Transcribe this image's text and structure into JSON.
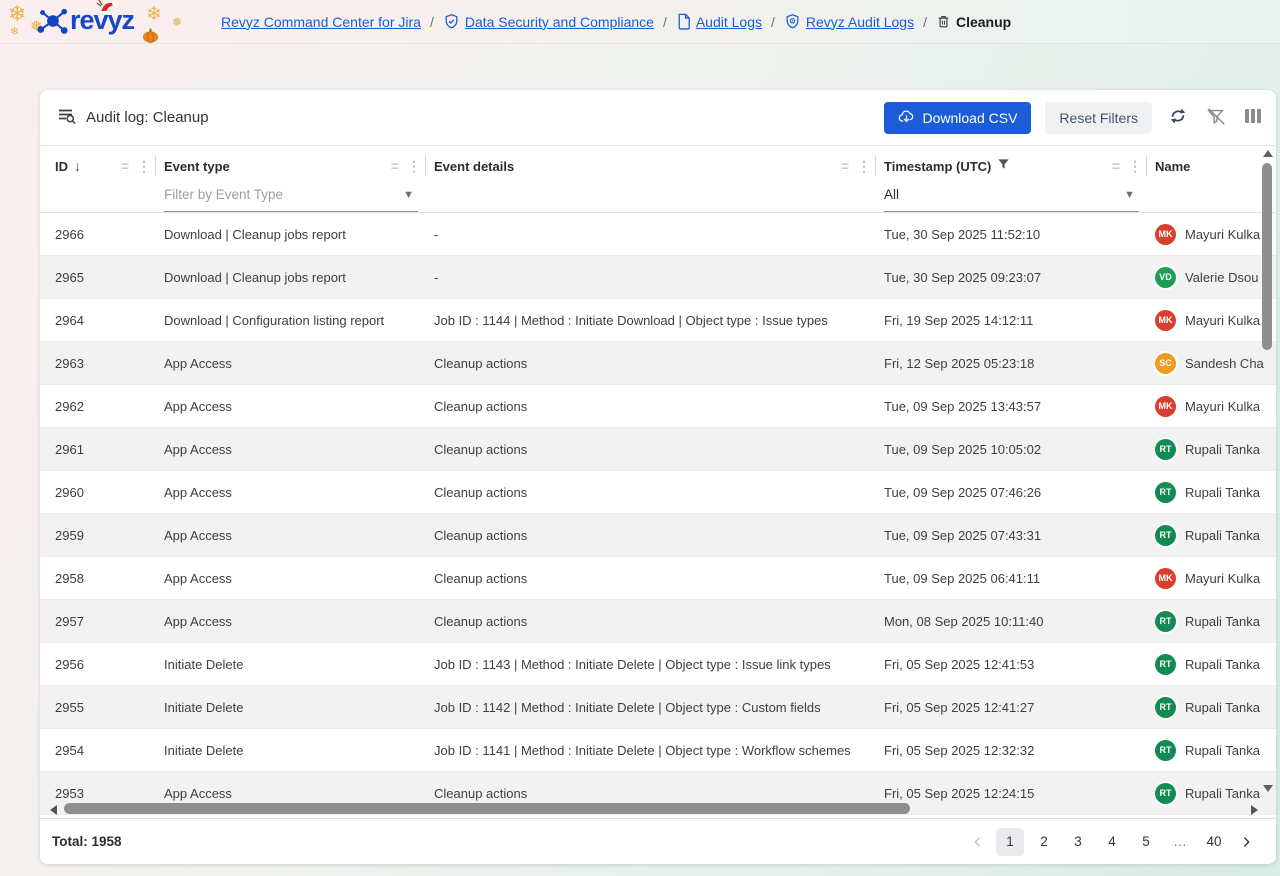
{
  "logo": {
    "brand": "revyz"
  },
  "breadcrumb": {
    "items": [
      {
        "label": "Revyz Command Center for Jira",
        "icon": null,
        "link": true
      },
      {
        "label": "Data Security and Compliance",
        "icon": "shield-check-icon",
        "link": true
      },
      {
        "label": "Audit Logs",
        "icon": "document-icon",
        "link": true
      },
      {
        "label": "Revyz Audit Logs",
        "icon": "shield-scan-icon",
        "link": true
      },
      {
        "label": "Cleanup",
        "icon": "trash-icon",
        "link": false
      }
    ],
    "separator": "/"
  },
  "toolbar": {
    "title": "Audit log: Cleanup",
    "title_icon": "list-search-icon",
    "download_label": "Download CSV",
    "download_icon": "cloud-download-icon",
    "reset_label": "Reset Filters",
    "icons": [
      "refresh-icon",
      "filter-off-icon",
      "columns-icon"
    ]
  },
  "table": {
    "columns": [
      {
        "label": "ID",
        "sort": "desc",
        "sort_glyph": "↓"
      },
      {
        "label": "Event type",
        "filter_placeholder": "Filter by Event Type"
      },
      {
        "label": "Event details"
      },
      {
        "label": "Timestamp (UTC)",
        "filtered": true,
        "filter_value": "All"
      },
      {
        "label": "Name"
      }
    ],
    "rows": [
      {
        "id": "2966",
        "event_type": "Download | Cleanup jobs report",
        "event_details": "-",
        "timestamp": "Tue, 30 Sep 2025 11:52:10",
        "initials": "MK",
        "name": "Mayuri Kulka",
        "avatar_color": "#d6402c"
      },
      {
        "id": "2965",
        "event_type": "Download | Cleanup jobs report",
        "event_details": "-",
        "timestamp": "Tue, 30 Sep 2025 09:23:07",
        "initials": "VD",
        "name": "Valerie Dsou",
        "avatar_color": "#1f9d55"
      },
      {
        "id": "2964",
        "event_type": "Download | Configuration listing report",
        "event_details": "Job ID : 1144 | Method : Initiate Download | Object type : Issue types",
        "timestamp": "Fri, 19 Sep 2025 14:12:11",
        "initials": "MK",
        "name": "Mayuri Kulka",
        "avatar_color": "#d6402c"
      },
      {
        "id": "2963",
        "event_type": "App Access",
        "event_details": "Cleanup actions",
        "timestamp": "Fri, 12 Sep 2025 05:23:18",
        "initials": "SC",
        "name": "Sandesh Cha",
        "avatar_color": "#f09a1e"
      },
      {
        "id": "2962",
        "event_type": "App Access",
        "event_details": "Cleanup actions",
        "timestamp": "Tue, 09 Sep 2025 13:43:57",
        "initials": "MK",
        "name": "Mayuri Kulka",
        "avatar_color": "#d6402c"
      },
      {
        "id": "2961",
        "event_type": "App Access",
        "event_details": "Cleanup actions",
        "timestamp": "Tue, 09 Sep 2025 10:05:02",
        "initials": "RT",
        "name": "Rupali Tanka",
        "avatar_color": "#128a52"
      },
      {
        "id": "2960",
        "event_type": "App Access",
        "event_details": "Cleanup actions",
        "timestamp": "Tue, 09 Sep 2025 07:46:26",
        "initials": "RT",
        "name": "Rupali Tanka",
        "avatar_color": "#128a52"
      },
      {
        "id": "2959",
        "event_type": "App Access",
        "event_details": "Cleanup actions",
        "timestamp": "Tue, 09 Sep 2025 07:43:31",
        "initials": "RT",
        "name": "Rupali Tanka",
        "avatar_color": "#128a52"
      },
      {
        "id": "2958",
        "event_type": "App Access",
        "event_details": "Cleanup actions",
        "timestamp": "Tue, 09 Sep 2025 06:41:11",
        "initials": "MK",
        "name": "Mayuri Kulka",
        "avatar_color": "#d6402c"
      },
      {
        "id": "2957",
        "event_type": "App Access",
        "event_details": "Cleanup actions",
        "timestamp": "Mon, 08 Sep 2025 10:11:40",
        "initials": "RT",
        "name": "Rupali Tanka",
        "avatar_color": "#128a52"
      },
      {
        "id": "2956",
        "event_type": "Initiate Delete",
        "event_details": "Job ID : 1143 | Method : Initiate Delete | Object type : Issue link types",
        "timestamp": "Fri, 05 Sep 2025 12:41:53",
        "initials": "RT",
        "name": "Rupali Tanka",
        "avatar_color": "#128a52"
      },
      {
        "id": "2955",
        "event_type": "Initiate Delete",
        "event_details": "Job ID : 1142 | Method : Initiate Delete | Object type : Custom fields",
        "timestamp": "Fri, 05 Sep 2025 12:41:27",
        "initials": "RT",
        "name": "Rupali Tanka",
        "avatar_color": "#128a52"
      },
      {
        "id": "2954",
        "event_type": "Initiate Delete",
        "event_details": "Job ID : 1141 | Method : Initiate Delete | Object type : Workflow schemes",
        "timestamp": "Fri, 05 Sep 2025 12:32:32",
        "initials": "RT",
        "name": "Rupali Tanka",
        "avatar_color": "#128a52"
      },
      {
        "id": "2953",
        "event_type": "App Access",
        "event_details": "Cleanup actions",
        "timestamp": "Fri, 05 Sep 2025 12:24:15",
        "initials": "RT",
        "name": "Rupali Tanka",
        "avatar_color": "#128a52"
      }
    ]
  },
  "pagination": {
    "total_label": "Total: 1958",
    "pages": [
      "1",
      "2",
      "3",
      "4",
      "5",
      "…",
      "40"
    ],
    "active_page": "1"
  },
  "colors": {
    "accent_blue": "#1b5cd7",
    "row_alt": "#f2f2f2",
    "avatar_red": "#d6402c",
    "avatar_green": "#1f9d55",
    "avatar_dark_green": "#128a52",
    "avatar_orange": "#f09a1e",
    "snowflake_gold": "#e7b44a"
  }
}
